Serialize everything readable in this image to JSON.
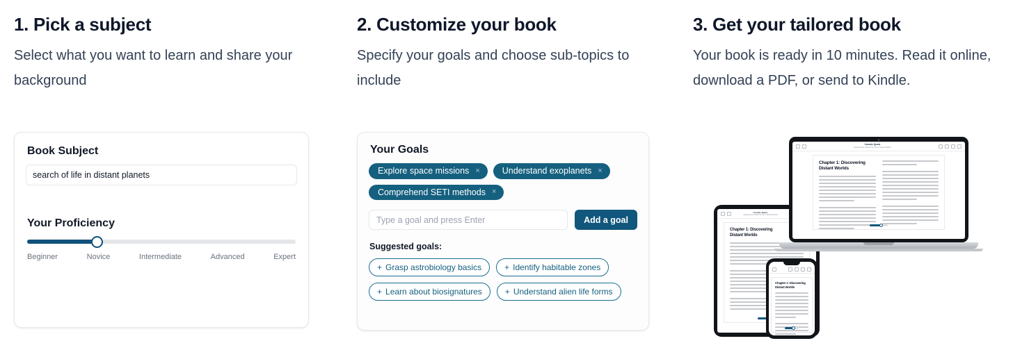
{
  "steps": [
    {
      "title": "1. Pick a subject",
      "description": "Select what you want to learn and share your background"
    },
    {
      "title": "2. Customize your book",
      "description": "Specify your goals and choose sub-topics to include"
    },
    {
      "title": "3. Get your tailored book",
      "description": "Your book is ready in 10 minutes. Read it online, download a PDF, or send to Kindle."
    }
  ],
  "subject_card": {
    "heading": "Book Subject",
    "input_value": "search of life in distant planets",
    "input_placeholder": "",
    "proficiency_heading": "Your Proficiency",
    "proficiency_levels": [
      "Beginner",
      "Novice",
      "Intermediate",
      "Advanced",
      "Expert"
    ],
    "proficiency_selected": "Novice",
    "proficiency_percent": 26
  },
  "goals_card": {
    "heading": "Your Goals",
    "goals": [
      "Explore space missions",
      "Understand exoplanets",
      "Comprehend SETI methods"
    ],
    "remove_icon": "×",
    "input_placeholder": "Type a goal and press Enter",
    "input_value": "",
    "add_button": "Add a goal",
    "suggested_label": "Suggested goals:",
    "suggested": [
      "Grasp astrobiology basics",
      "Identify habitable zones",
      "Learn about biosignatures",
      "Understand alien life forms"
    ],
    "add_icon": "+"
  },
  "devices": {
    "chapter_title_line1": "Chapter 1: Discovering",
    "chapter_title_line2": "Distant Worlds",
    "app_title": "Cosmic Quest",
    "app_subtitle": "Exploring the Search for Life in Distant Worlds"
  },
  "colors": {
    "accent": "#11567c",
    "chip": "#15607f",
    "chip_outline": "#1b6e90",
    "heading": "#0f172a",
    "body": "#334155",
    "border": "#e5e7eb"
  }
}
